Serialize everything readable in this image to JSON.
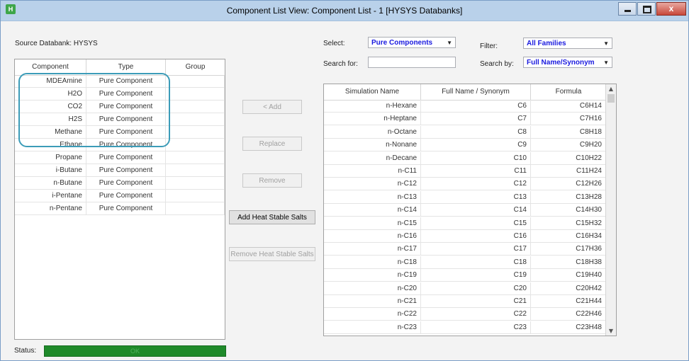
{
  "window": {
    "title": "Component List View: Component List - 1 [HYSYS Databanks]",
    "icon": "hysys-app-icon"
  },
  "source_databank": "Source Databank: HYSYS",
  "left_grid": {
    "headers": [
      "Component",
      "Type",
      "Group"
    ],
    "rows": [
      {
        "component": "MDEAmine",
        "type": "Pure Component",
        "group": ""
      },
      {
        "component": "H2O",
        "type": "Pure Component",
        "group": ""
      },
      {
        "component": "CO2",
        "type": "Pure Component",
        "group": ""
      },
      {
        "component": "H2S",
        "type": "Pure Component",
        "group": ""
      },
      {
        "component": "Methane",
        "type": "Pure Component",
        "group": ""
      },
      {
        "component": "Ethane",
        "type": "Pure Component",
        "group": ""
      },
      {
        "component": "Propane",
        "type": "Pure Component",
        "group": ""
      },
      {
        "component": "i-Butane",
        "type": "Pure Component",
        "group": ""
      },
      {
        "component": "n-Butane",
        "type": "Pure Component",
        "group": ""
      },
      {
        "component": "i-Pentane",
        "type": "Pure Component",
        "group": ""
      },
      {
        "component": "n-Pentane",
        "type": "Pure Component",
        "group": ""
      }
    ]
  },
  "buttons": {
    "add": "< Add",
    "replace": "Replace",
    "remove": "Remove",
    "add_hss": "Add Heat Stable Salts",
    "remove_hss": "Remove Heat Stable Salts"
  },
  "filters": {
    "select_label": "Select:",
    "select_value": "Pure Components",
    "filter_label": "Filter:",
    "filter_value": "All Families",
    "search_for_label": "Search for:",
    "search_for_value": "",
    "search_by_label": "Search by:",
    "search_by_value": "Full Name/Synonym"
  },
  "right_grid": {
    "headers": [
      "Simulation Name",
      "Full Name / Synonym",
      "Formula"
    ],
    "rows": [
      {
        "sim": "n-Hexane",
        "full": "C6",
        "formula": "C6H14"
      },
      {
        "sim": "n-Heptane",
        "full": "C7",
        "formula": "C7H16"
      },
      {
        "sim": "n-Octane",
        "full": "C8",
        "formula": "C8H18"
      },
      {
        "sim": "n-Nonane",
        "full": "C9",
        "formula": "C9H20"
      },
      {
        "sim": "n-Decane",
        "full": "C10",
        "formula": "C10H22"
      },
      {
        "sim": "n-C11",
        "full": "C11",
        "formula": "C11H24"
      },
      {
        "sim": "n-C12",
        "full": "C12",
        "formula": "C12H26"
      },
      {
        "sim": "n-C13",
        "full": "C13",
        "formula": "C13H28"
      },
      {
        "sim": "n-C14",
        "full": "C14",
        "formula": "C14H30"
      },
      {
        "sim": "n-C15",
        "full": "C15",
        "formula": "C15H32"
      },
      {
        "sim": "n-C16",
        "full": "C16",
        "formula": "C16H34"
      },
      {
        "sim": "n-C17",
        "full": "C17",
        "formula": "C17H36"
      },
      {
        "sim": "n-C18",
        "full": "C18",
        "formula": "C18H38"
      },
      {
        "sim": "n-C19",
        "full": "C19",
        "formula": "C19H40"
      },
      {
        "sim": "n-C20",
        "full": "C20",
        "formula": "C20H42"
      },
      {
        "sim": "n-C21",
        "full": "C21",
        "formula": "C21H44"
      },
      {
        "sim": "n-C22",
        "full": "C22",
        "formula": "C22H46"
      },
      {
        "sim": "n-C23",
        "full": "C23",
        "formula": "C23H48"
      }
    ]
  },
  "status": {
    "label": "Status:",
    "value": "OK",
    "color": "#1f8a2a"
  },
  "colors": {
    "titlebar": "#b9d1ea",
    "select_text": "#1a1adf",
    "callout": "#3c9cb8"
  }
}
